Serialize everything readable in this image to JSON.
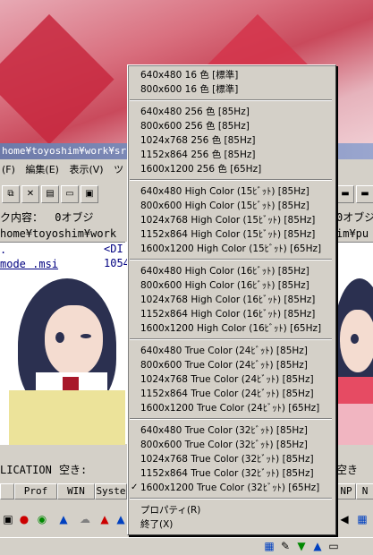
{
  "window": {
    "title": "home¥toyoshim¥work¥src¥",
    "menu": [
      "(F)",
      "編集(E)",
      "表示(V)",
      "ツ"
    ],
    "info_left": "ク内容：　 0オブジ",
    "info_right": "0オブジ",
    "path_left": "home¥toyoshim¥work",
    "path_right": "im¥pu",
    "files": [
      ".",
      "mode .msi"
    ],
    "file_right_cols": [
      "<DI",
      "1054"
    ],
    "status_left": "LICATION",
    "status_mid": "空き:",
    "status_right": "空き",
    "tabs": [
      "",
      "Prof",
      "WIN",
      "Syste",
      "NP",
      "N"
    ]
  },
  "context_menu": {
    "groups": [
      [
        "640x480 16 色 [標準]",
        "800x600 16 色 [標準]"
      ],
      [
        "640x480 256 色 [85Hz]",
        "800x600 256 色 [85Hz]",
        "1024x768 256 色 [85Hz]",
        "1152x864 256 色 [85Hz]",
        "1600x1200 256 色 [65Hz]"
      ],
      [
        "640x480 High Color (15ﾋﾞｯﾄ) [85Hz]",
        "800x600 High Color (15ﾋﾞｯﾄ) [85Hz]",
        "1024x768 High Color (15ﾋﾞｯﾄ) [85Hz]",
        "1152x864 High Color (15ﾋﾞｯﾄ) [85Hz]",
        "1600x1200 High Color (15ﾋﾞｯﾄ) [65Hz]"
      ],
      [
        "640x480 High Color (16ﾋﾞｯﾄ) [85Hz]",
        "800x600 High Color (16ﾋﾞｯﾄ) [85Hz]",
        "1024x768 High Color (16ﾋﾞｯﾄ) [85Hz]",
        "1152x864 High Color (16ﾋﾞｯﾄ) [85Hz]",
        "1600x1200 High Color (16ﾋﾞｯﾄ) [65Hz]"
      ],
      [
        "640x480 True Color (24ﾋﾞｯﾄ) [85Hz]",
        "800x600 True Color (24ﾋﾞｯﾄ) [85Hz]",
        "1024x768 True Color (24ﾋﾞｯﾄ) [85Hz]",
        "1152x864 True Color (24ﾋﾞｯﾄ) [85Hz]",
        "1600x1200 True Color (24ﾋﾞｯﾄ) [65Hz]"
      ],
      [
        "640x480 True Color (32ﾋﾞｯﾄ) [85Hz]",
        "800x600 True Color (32ﾋﾞｯﾄ) [85Hz]",
        "1024x768 True Color (32ﾋﾞｯﾄ) [85Hz]",
        "1152x864 True Color (32ﾋﾞｯﾄ) [85Hz]",
        "1600x1200 True Color (32ﾋﾞｯﾄ) [65Hz]"
      ],
      [
        "プロパティ(R)",
        "終了(X)"
      ]
    ],
    "checked_item": "1600x1200 True Color (32ﾋﾞｯﾄ) [65Hz]",
    "check_glyph": "✓"
  },
  "colors": {
    "menu_bg": "#d4d0c8",
    "title_bar": "#6d7aa9",
    "accent_red": "#c8283f"
  }
}
